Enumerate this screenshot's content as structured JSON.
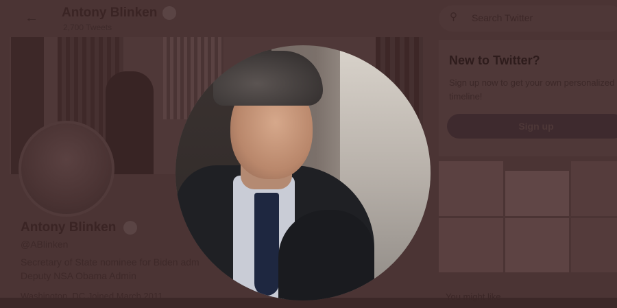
{
  "header": {
    "back_icon": "arrow-left-icon",
    "name": "Antony Blinken",
    "tweets_count": "2,700 Tweets"
  },
  "profile": {
    "name": "Antony Blinken",
    "handle": "@ABlinken",
    "bio_line1": "Secretary of State nominee for Biden adm",
    "bio_line2": "Deputy NSA Obama Admin",
    "meta_line": "Washington, DC   Joined March 2011"
  },
  "sidebar": {
    "search_placeholder": "Search Twitter",
    "new_title": "New to Twitter?",
    "new_desc_line1": "Sign up now to get your own personalized",
    "new_desc_line2": "timeline!",
    "signup_label": "Sign up",
    "follows_text": "You might like"
  },
  "colors": {
    "overlay": "#4b3434",
    "verified_badge": "#5a4444"
  }
}
